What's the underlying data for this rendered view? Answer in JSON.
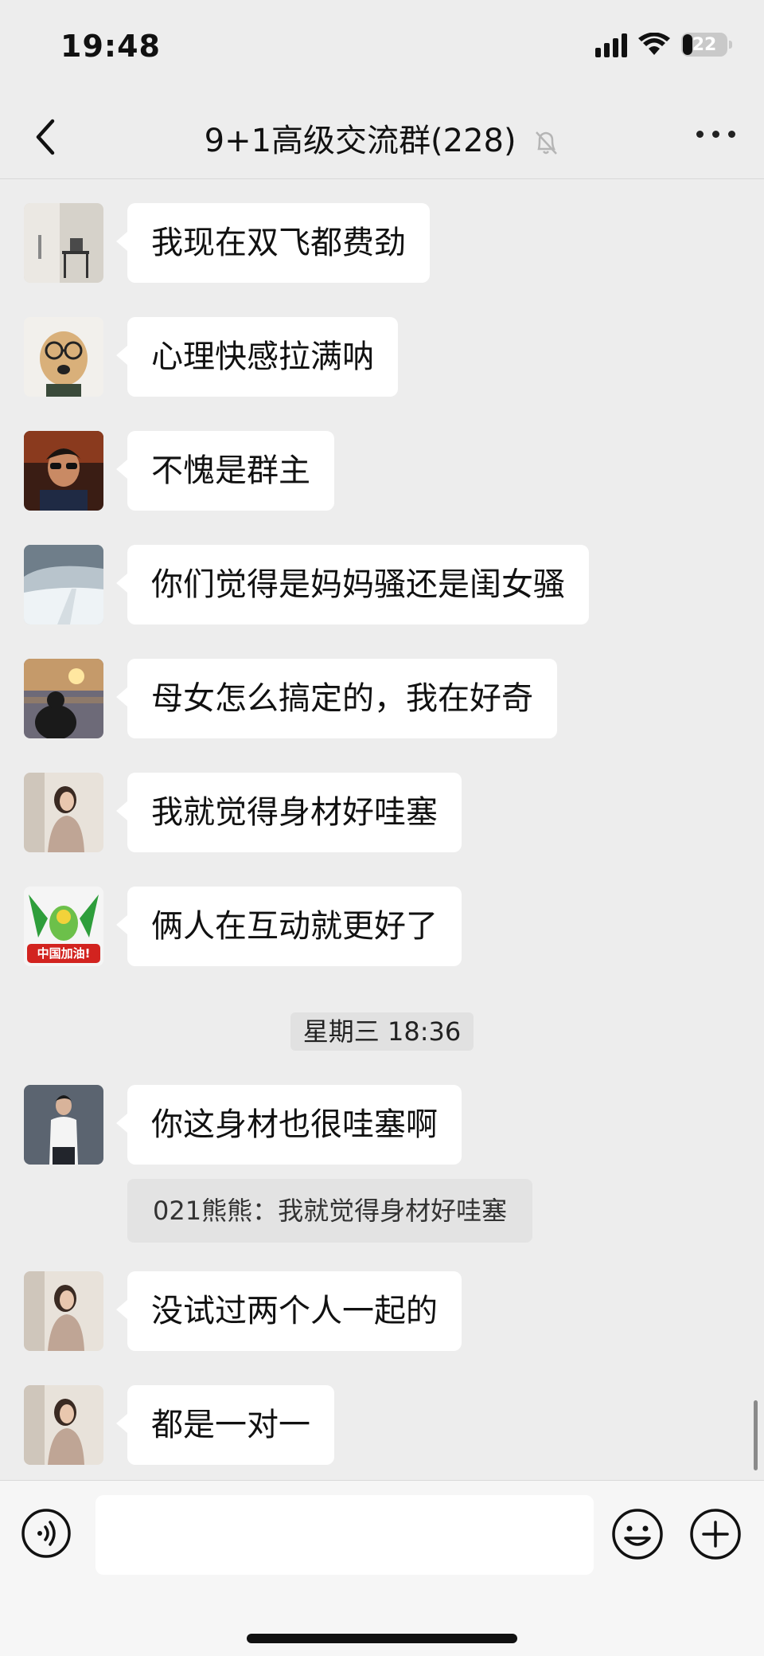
{
  "status_bar": {
    "time": "19:48",
    "battery": "22",
    "battery_level": 0.22
  },
  "header": {
    "title": "9+1高级交流群(228)",
    "back_icon": "chevron-left-icon",
    "mute_icon": "bell-slash-icon",
    "more_icon": "more-horizontal-icon"
  },
  "messages": [
    {
      "text": "我现在双飞都费劲",
      "avatar": "room-lamp-avatar"
    },
    {
      "text": "心理快感拉满呐",
      "avatar": "dog-glasses-avatar"
    },
    {
      "text": "不愧是群主",
      "avatar": "man-sunglasses-avatar"
    },
    {
      "text": "你们觉得是妈妈骚还是闺女骚",
      "avatar": "snowy-road-avatar"
    },
    {
      "text": "母女怎么搞定的，我在好奇",
      "avatar": "sunset-silhouette-avatar"
    },
    {
      "text": "我就觉得身材好哇塞",
      "avatar": "woman-portrait-avatar"
    },
    {
      "text": "俩人在互动就更好了",
      "avatar": "china-cheer-avatar",
      "avatar_text": "中国加油!"
    }
  ],
  "timestamp": "星期三 18:36",
  "messages_after": [
    {
      "text": "你这身材也很哇塞啊",
      "avatar": "man-white-shirt-avatar",
      "quote": "021熊熊：我就觉得身材好哇塞"
    },
    {
      "text": "没试过两个人一起的",
      "avatar": "woman-portrait-avatar"
    },
    {
      "text": "都是一对一",
      "avatar": "woman-portrait-avatar"
    }
  ],
  "input_bar": {
    "voice_icon": "voice-icon",
    "emoji_icon": "emoji-icon",
    "plus_icon": "plus-circle-icon",
    "input_value": ""
  }
}
